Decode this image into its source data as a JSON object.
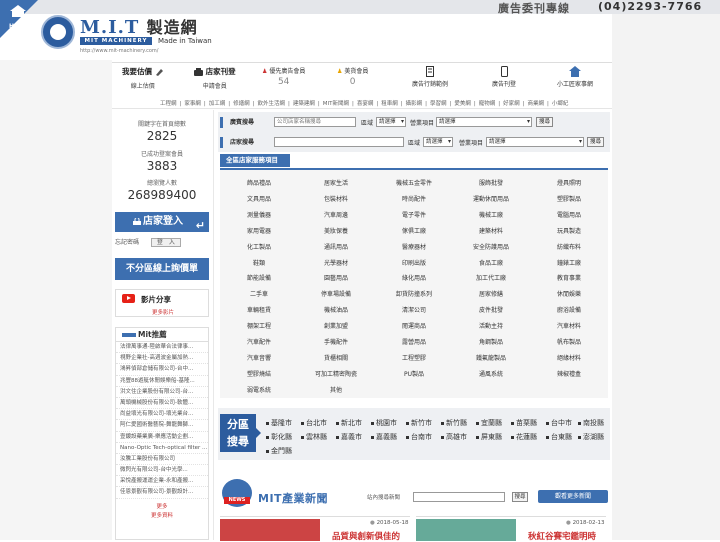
{
  "header": {
    "ad_label": "廣告委刊專線",
    "ad_phone": "(04)2293-7766",
    "home_label": "HOME",
    "logo_brand": "M.I.T",
    "logo_zh": "製造網",
    "logo_sub": "MIT MACHINERY",
    "logo_made": "Made in Taiwan",
    "logo_url": "http://www.mit-machinery.com/"
  },
  "topnav": {
    "quote_title": "我要估價",
    "quote_sub": "線上估價",
    "store_title": "店家刊登",
    "store_sub": "申請會員",
    "premium_label": "優先廣告會員",
    "premium_count": "54",
    "beauty_label": "美貨會員",
    "beauty_count": "0",
    "ad_example": "廣告行銷範例",
    "store_example": "廣告刊登",
    "ai_example": "小工匠家事網"
  },
  "catlinks": [
    "工程網",
    "家事網",
    "加工網",
    "修繕網",
    "飲外生活網",
    "建築建網",
    "MIT新聞網",
    "喜宴網",
    "租車網",
    "攝影網",
    "學習網",
    "愛美網",
    "寵物網",
    "好家網",
    "商業網",
    "小鄉紀"
  ],
  "stats": [
    {
      "label": "關鍵字在首頁總數",
      "value": "2825"
    },
    {
      "label": "已成功登案會員",
      "value": "3883"
    },
    {
      "label": "總瀏覽人數",
      "value": "268989400"
    }
  ],
  "login": {
    "title": "店家登入",
    "forgot": "忘記密碼",
    "login_btn": "登　入"
  },
  "cross_area": "不分區線上詢價單",
  "video": {
    "title": "影片分享",
    "more": "更多影片"
  },
  "mit_rec": {
    "title": "Mit推薦",
    "items": [
      "法律萬事通-陸啟華合法律事...",
      "視野企業社-高週波金屬加熱...",
      "鴻昇偵部倉儲有限公司-台中...",
      "兆豐88遊艇休閒娛樂船-基隆...",
      "洪文住企業股份有限公司-台...",
      "萬頭機械股份有限公司-軟體...",
      "尚益壞光有限公司-壞光業台...",
      "阿仁愛國術醫藝院-舞龍舞獅...",
      "壹鍍設藥業廣-樂應活動企劃...",
      "Nano-Optic Tech-optical filter ...",
      "汝騰工業股份有限公司",
      "微閃光有限公司-台中光學...",
      "采悅產搬運運企業-永和產搬...",
      "佳恩景觀有限公司-景觀設計..."
    ],
    "more": "更多",
    "more_data": "更多資料"
  },
  "search": {
    "row1_tag": "廣賓搜尋",
    "row1_placeholder": "公司店家名稱搜尋",
    "region_label": "區域",
    "region_value": "請選擇",
    "business_label": "營業項目",
    "business_value": "請選擇",
    "go": "搜尋",
    "row2_tag": "店家搜尋"
  },
  "services": {
    "head": "全區店家服務項目",
    "items": [
      "飾品禮品",
      "居家生活",
      "機械五金零件",
      "服飾批發",
      "燈具照明",
      "文具用品",
      "包裝材料",
      "時尚配件",
      "運動休閒用品",
      "塑膠製品",
      "測量儀器",
      "汽車周邊",
      "電子零件",
      "機械工廠",
      "電腦用品",
      "家用電器",
      "美妝保養",
      "傢俱工廠",
      "建築材料",
      "玩具製造",
      "化工製品",
      "通訊用品",
      "醫療器材",
      "安全防護用品",
      "紡織布料",
      "鞋類",
      "光學器材",
      "印刷出版",
      "食品工廠",
      "鐘錶工廠",
      "節能設備",
      "園藝用品",
      "綠化用品",
      "加工代工廠",
      "教育事業",
      "二手車",
      "停車場設備",
      "卸貨防撞系列",
      "居家修繕",
      "休閒娛樂",
      "車輛租賃",
      "機械油品",
      "清潔公司",
      "皮件批發",
      "廚浴設備",
      "棚架工程",
      "創業加盟",
      "閱運商品",
      "活動主持",
      "汽車材料",
      "汽車配件",
      "手機配件",
      "露營用品",
      "角鋼製品",
      "帆布製品",
      "汽車音響",
      "貨櫃相關",
      "工程塑膠",
      "鐵氟龍製品",
      "絕緣材料",
      "塑膠燒結",
      "可加工精密陶瓷",
      "PU製品",
      "通風系統",
      "辣椒禮盒",
      "弱電系統",
      "其他"
    ]
  },
  "region_search": {
    "badge_1": "分區",
    "badge_2": "搜尋",
    "items": [
      "基隆市",
      "台北市",
      "新北市",
      "桃園市",
      "新竹市",
      "新竹縣",
      "宜蘭縣",
      "苗栗縣",
      "台中市",
      "南投縣",
      "彰化縣",
      "雲林縣",
      "嘉義市",
      "嘉義縣",
      "台南市",
      "高雄市",
      "屏東縣",
      "花蓮縣",
      "台東縣",
      "澎湖縣",
      "金門縣"
    ]
  },
  "news": {
    "logo_label": "NEWS",
    "title": "MIT產業新聞",
    "search_label": "站內搜尋新聞",
    "go": "搜尋",
    "more": "觀看更多新聞",
    "cards": [
      {
        "date": "2018-05-18",
        "headline": "品質與創新俱佳的"
      },
      {
        "date": "2018-02-13",
        "headline": "秋紅谷賽宅鑑明時"
      }
    ]
  },
  "colors": {
    "accent": "#3d6fb0",
    "news_red": "#c33"
  }
}
